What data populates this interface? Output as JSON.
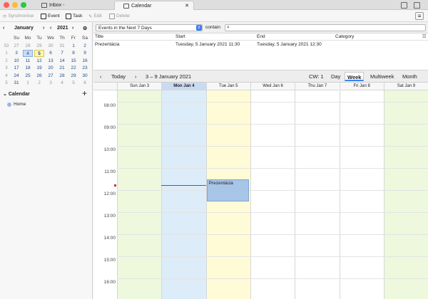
{
  "titlebar": {
    "tabs": [
      {
        "label": "Inbox -",
        "icon": "mail-icon"
      },
      {
        "label": "Calendar",
        "icon": "calendar-icon"
      }
    ],
    "close_glyph": "✕"
  },
  "toolbar": {
    "synchronise": "Synchronise",
    "event": "Event",
    "task": "Task",
    "edit": "Edit",
    "delete": "Delete"
  },
  "minical": {
    "month": "January",
    "year": "2021",
    "day_names": [
      "Su",
      "Mo",
      "Tu",
      "We",
      "Th",
      "Fr",
      "Sa"
    ],
    "weeks": [
      {
        "wk": "53",
        "days": [
          "27",
          "28",
          "29",
          "30",
          "31",
          "1",
          "2"
        ]
      },
      {
        "wk": "1",
        "days": [
          "3",
          "4",
          "5",
          "6",
          "7",
          "8",
          "9"
        ]
      },
      {
        "wk": "2",
        "days": [
          "10",
          "11",
          "12",
          "13",
          "14",
          "15",
          "16"
        ]
      },
      {
        "wk": "3",
        "days": [
          "17",
          "18",
          "19",
          "20",
          "21",
          "22",
          "23"
        ]
      },
      {
        "wk": "4",
        "days": [
          "24",
          "25",
          "26",
          "27",
          "28",
          "29",
          "30"
        ]
      },
      {
        "wk": "5",
        "days": [
          "31",
          "1",
          "2",
          "3",
          "4",
          "5",
          "6"
        ]
      }
    ]
  },
  "calendars": {
    "title": "Calendar",
    "items": [
      {
        "name": "Home",
        "color": "#9bb8e0"
      }
    ]
  },
  "filter": {
    "select_value": "Events in the Next 7 Days",
    "contain": "contain"
  },
  "list": {
    "headers": {
      "title": "Title",
      "start": "Start",
      "end": "End",
      "category": "Category"
    },
    "rows": [
      {
        "title": "Prezentácia",
        "start": "Tuesday, 5 January 2021 11:30",
        "end": "Tuesday, 5 January 2021 12:30",
        "category": ""
      }
    ]
  },
  "viewbar": {
    "today": "Today",
    "range": "3 – 9 January 2021",
    "cw": "CW: 1",
    "views": [
      "Day",
      "Week",
      "Multiweek",
      "Month"
    ],
    "active_view": "Week"
  },
  "week": {
    "days": [
      "Sun Jan 3",
      "Mon Jan 4",
      "Tue Jan 5",
      "Wed Jan 6",
      "Thu Jan 7",
      "Fri Jan 8",
      "Sat Jan 9"
    ],
    "hours": [
      "08:00",
      "09:00",
      "10:00",
      "11:00",
      "12:00",
      "13:00",
      "14:00",
      "15:00",
      "16:00"
    ],
    "event": {
      "title": "Prezentácia",
      "day": "Tue Jan 5",
      "start": "11:30",
      "end": "12:30"
    },
    "colors": {
      "weekend": "#eef8dd",
      "selected": "#dcecf9",
      "today": "#fffbd6",
      "event": "#a8c4e6",
      "now_line": "#d32f2f"
    }
  }
}
